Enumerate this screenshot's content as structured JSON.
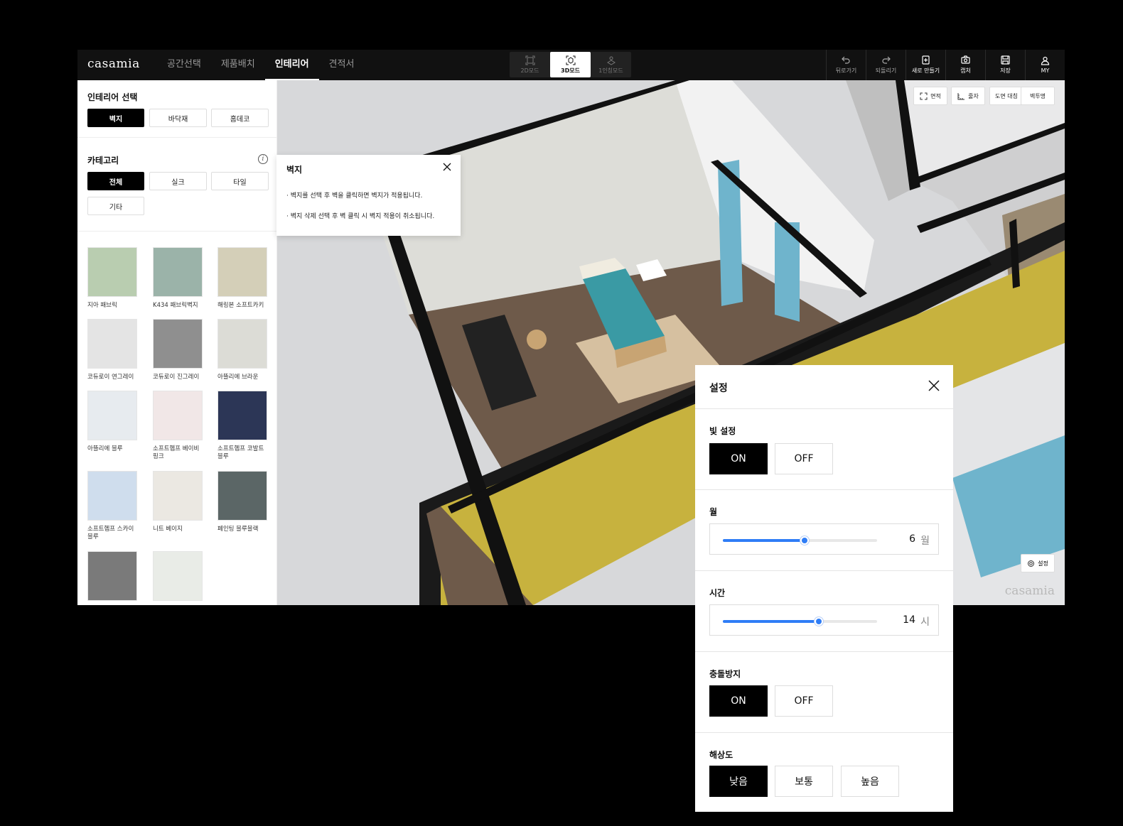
{
  "app": {
    "logo": "casamia",
    "nav": [
      {
        "label": "공간선택",
        "active": false
      },
      {
        "label": "제품배치",
        "active": false
      },
      {
        "label": "인테리어",
        "active": true
      },
      {
        "label": "견적서",
        "active": false
      }
    ],
    "modes": [
      {
        "label": "2D모드",
        "icon": "2d-mode-icon",
        "active": false
      },
      {
        "label": "3D모드",
        "icon": "3d-mode-icon",
        "active": true
      },
      {
        "label": "1인칭모드",
        "icon": "first-person-icon",
        "active": false
      }
    ],
    "tools": [
      {
        "label": "뒤로가기",
        "icon": "undo-icon"
      },
      {
        "label": "되돌리기",
        "icon": "redo-icon"
      },
      {
        "label": "새로 만들기",
        "icon": "new-file-icon"
      },
      {
        "label": "캡처",
        "icon": "camera-icon"
      },
      {
        "label": "저장",
        "icon": "save-icon"
      },
      {
        "label": "MY",
        "icon": "user-icon"
      }
    ]
  },
  "sidebar": {
    "interior_title": "인테리어 선택",
    "interior_tabs": [
      {
        "label": "벽지",
        "selected": true
      },
      {
        "label": "바닥재",
        "selected": false
      },
      {
        "label": "홈데코",
        "selected": false
      }
    ],
    "category_title": "카테고리",
    "categories": [
      {
        "label": "전체",
        "selected": true
      },
      {
        "label": "실크",
        "selected": false
      },
      {
        "label": "타일",
        "selected": false
      },
      {
        "label": "기타",
        "selected": false
      }
    ],
    "swatches": [
      {
        "name": "지아 패브릭",
        "color": "#b9cdb0"
      },
      {
        "name": "K434 패브릭벽지",
        "color": "#9bb3a9"
      },
      {
        "name": "해링본 소프트카키",
        "color": "#d4cfb8"
      },
      {
        "name": "코듀로이 연그레이",
        "color": "#e4e4e4"
      },
      {
        "name": "코듀로이 진그레이",
        "color": "#8f8f8f"
      },
      {
        "name": "아뜰리에 브라운",
        "color": "#dcdcd6"
      },
      {
        "name": "아뜰리에 블루",
        "color": "#e7ebef"
      },
      {
        "name": "소프트헴프 베이비 핑크",
        "color": "#f1e7e7"
      },
      {
        "name": "소프트헴프 코발트 블루",
        "color": "#2c3656"
      },
      {
        "name": "소프트헴프 스카이 블루",
        "color": "#cfdded"
      },
      {
        "name": "니트 베이지",
        "color": "#ebe8e2"
      },
      {
        "name": "페인팅 블루블랙",
        "color": "#5b6666"
      },
      {
        "name": "",
        "color": "#7a7a7a"
      },
      {
        "name": "",
        "color": "#e9ece7"
      }
    ]
  },
  "viewport": {
    "buttons": [
      {
        "label": "면적",
        "icon": "area-icon"
      },
      {
        "label": "줄자",
        "icon": "ruler-icon"
      },
      {
        "label": "도면 대칭",
        "icon": ""
      },
      {
        "label": "벽투명",
        "icon": ""
      }
    ],
    "settings_label": "설정",
    "watermark": "casamia"
  },
  "tooltip": {
    "title": "벽지",
    "lines": [
      "· 벽지를 선택 후 벽을 클릭하면 벽지가 적용됩니다.",
      "· 벽지 삭제 선택 후 벽 클릭 시 벽지 적용이 취소됩니다."
    ]
  },
  "settings": {
    "title": "설정",
    "light": {
      "label": "빛 설정",
      "on": "ON",
      "off": "OFF",
      "value": "ON"
    },
    "month": {
      "label": "월",
      "value": "6",
      "unit": "월",
      "level": 0.53
    },
    "time": {
      "label": "시간",
      "value": "14",
      "unit": "시",
      "level": 0.62
    },
    "collision": {
      "label": "충돌방지",
      "on": "ON",
      "off": "OFF",
      "value": "ON"
    },
    "resolution": {
      "label": "해상도",
      "options": [
        "낮음",
        "보통",
        "높음"
      ],
      "value": "낮음"
    }
  }
}
